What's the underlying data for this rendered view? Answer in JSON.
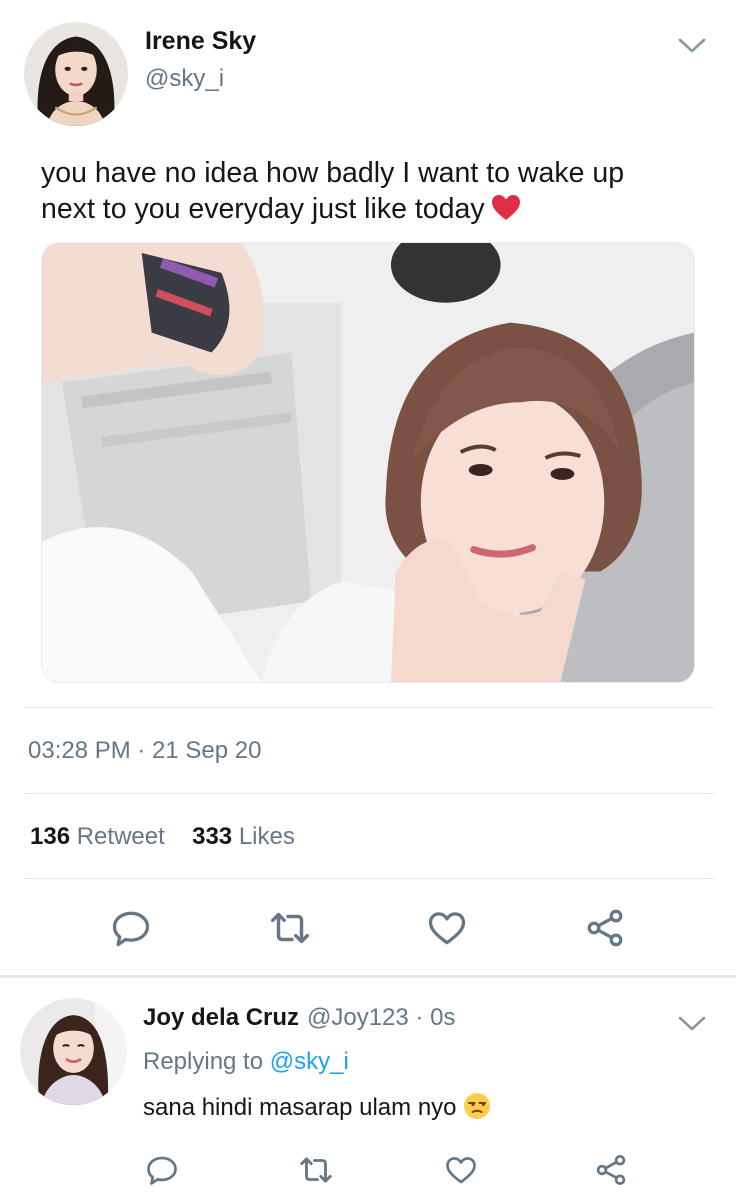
{
  "tweet": {
    "author_name": "Irene Sky",
    "author_handle": "@sky_i",
    "text": "you have no idea how badly I want to wake up next to you everyday just like today",
    "emoji": "red-heart",
    "timestamp": "03:28 PM · 21 Sep 20",
    "retweet_count": "136",
    "retweet_label": "Retweet",
    "like_count": "333",
    "like_label": "Likes"
  },
  "actions": [
    "reply-icon",
    "retweet-icon",
    "like-icon",
    "share-icon"
  ],
  "reply": {
    "author_name": "Joy dela Cruz",
    "meta": "@Joy123 · 0s",
    "replying_prefix": "Replying to",
    "replying_handle": "@sky_i",
    "text": "sana hindi masarap ulam nyo",
    "emoji": "unamused-face"
  },
  "colors": {
    "text": "#14171a",
    "secondary": "#657786",
    "accent": "#1da1f2",
    "icon": "#657786",
    "divider": "#e1e8ed"
  }
}
